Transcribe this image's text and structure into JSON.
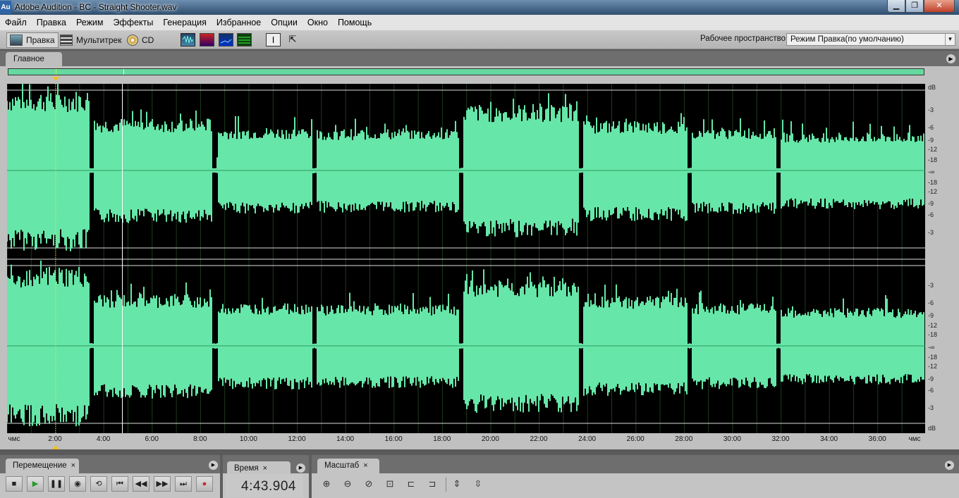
{
  "window": {
    "app_icon": "Au",
    "title": "Adobe Audition - BC - Straight Shooter.wav",
    "buttons": {
      "minimize": "▁",
      "maximize": "❐",
      "close": "✕"
    }
  },
  "menu": [
    "Файл",
    "Правка",
    "Режим",
    "Эффекты",
    "Генерация",
    "Избранное",
    "Опции",
    "Окно",
    "Помощь"
  ],
  "toolbar": {
    "edit_label": "Правка",
    "multitrack_label": "Мультитрек",
    "cd_label": "CD",
    "workspace_label": "Рабочее пространство:",
    "workspace_value": "Режим Правка(по умолчанию)"
  },
  "main_panel": {
    "tab_label": "Главное"
  },
  "waveform": {
    "channels": 2,
    "color": "#66e6a8",
    "db_labels": [
      "dB",
      "-3",
      "-6",
      "-9",
      "-12",
      "-18",
      "-∞",
      "-18",
      "-12",
      "-9",
      "-6",
      "-3"
    ],
    "db_labels_bottom": [
      "-3",
      "-6",
      "-9",
      "-12",
      "-18",
      "-∞",
      "-18",
      "-12",
      "-9",
      "-6",
      "-3",
      "dB"
    ]
  },
  "timeline": {
    "start_label": "чмс",
    "end_label": "чмс",
    "ticks": [
      "2:00",
      "4:00",
      "6:00",
      "8:00",
      "10:00",
      "12:00",
      "14:00",
      "16:00",
      "18:00",
      "20:00",
      "22:00",
      "24:00",
      "26:00",
      "28:00",
      "30:00",
      "32:00",
      "34:00",
      "36:00"
    ]
  },
  "transport": {
    "tab_label": "Перемещение",
    "close": "×",
    "buttons": [
      "stop-icon",
      "play-icon",
      "pause-icon",
      "play-from-cursor-icon",
      "loop-icon",
      "go-to-start-icon",
      "rewind-icon",
      "fast-forward-icon",
      "go-to-end-icon",
      "record-icon"
    ]
  },
  "time_panel": {
    "tab_label": "Время",
    "close": "×",
    "value": "4:43.904"
  },
  "zoom_panel": {
    "tab_label": "Масштаб",
    "close": "×"
  }
}
